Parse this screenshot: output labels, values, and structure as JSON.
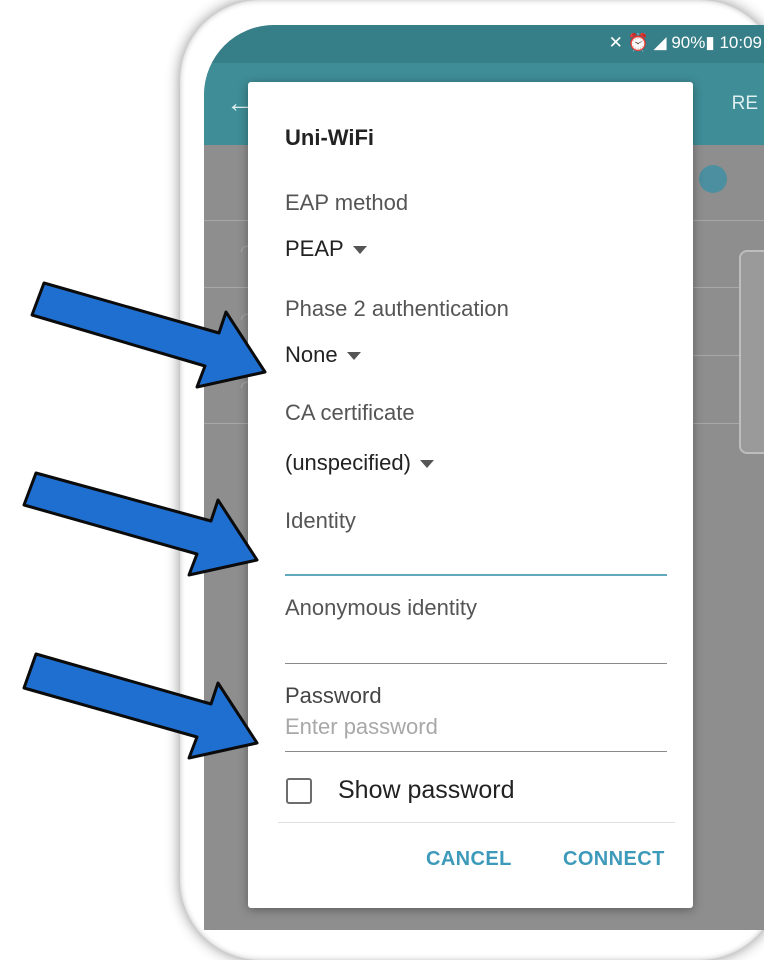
{
  "status_bar": {
    "icons": [
      "mute-icon",
      "alarm-icon",
      "signal-icon",
      "battery-icon"
    ],
    "battery": "90%",
    "time": "10:09"
  },
  "app_bar": {
    "back_icon": "arrow-left-icon",
    "more_text": "RE"
  },
  "dialog": {
    "title": "Uni-WiFi",
    "eap_method": {
      "label": "EAP method",
      "value": "PEAP"
    },
    "phase2": {
      "label": "Phase 2 authentication",
      "value": "None"
    },
    "ca_certificate": {
      "label": "CA certificate",
      "value": "(unspecified)"
    },
    "identity": {
      "label": "Identity",
      "value": ""
    },
    "anonymous_identity": {
      "label": "Anonymous identity",
      "value": ""
    },
    "password": {
      "label": "Password",
      "placeholder": "Enter password",
      "value": ""
    },
    "show_password": {
      "label": "Show password",
      "checked": false
    },
    "buttons": {
      "cancel": "CANCEL",
      "connect": "CONNECT"
    }
  },
  "colors": {
    "status_bar": "#367f88",
    "app_bar": "#3f8d97",
    "accent": "#3e9aba",
    "arrow_fill": "#1f6fd1",
    "arrow_stroke": "#0b0b0b"
  }
}
